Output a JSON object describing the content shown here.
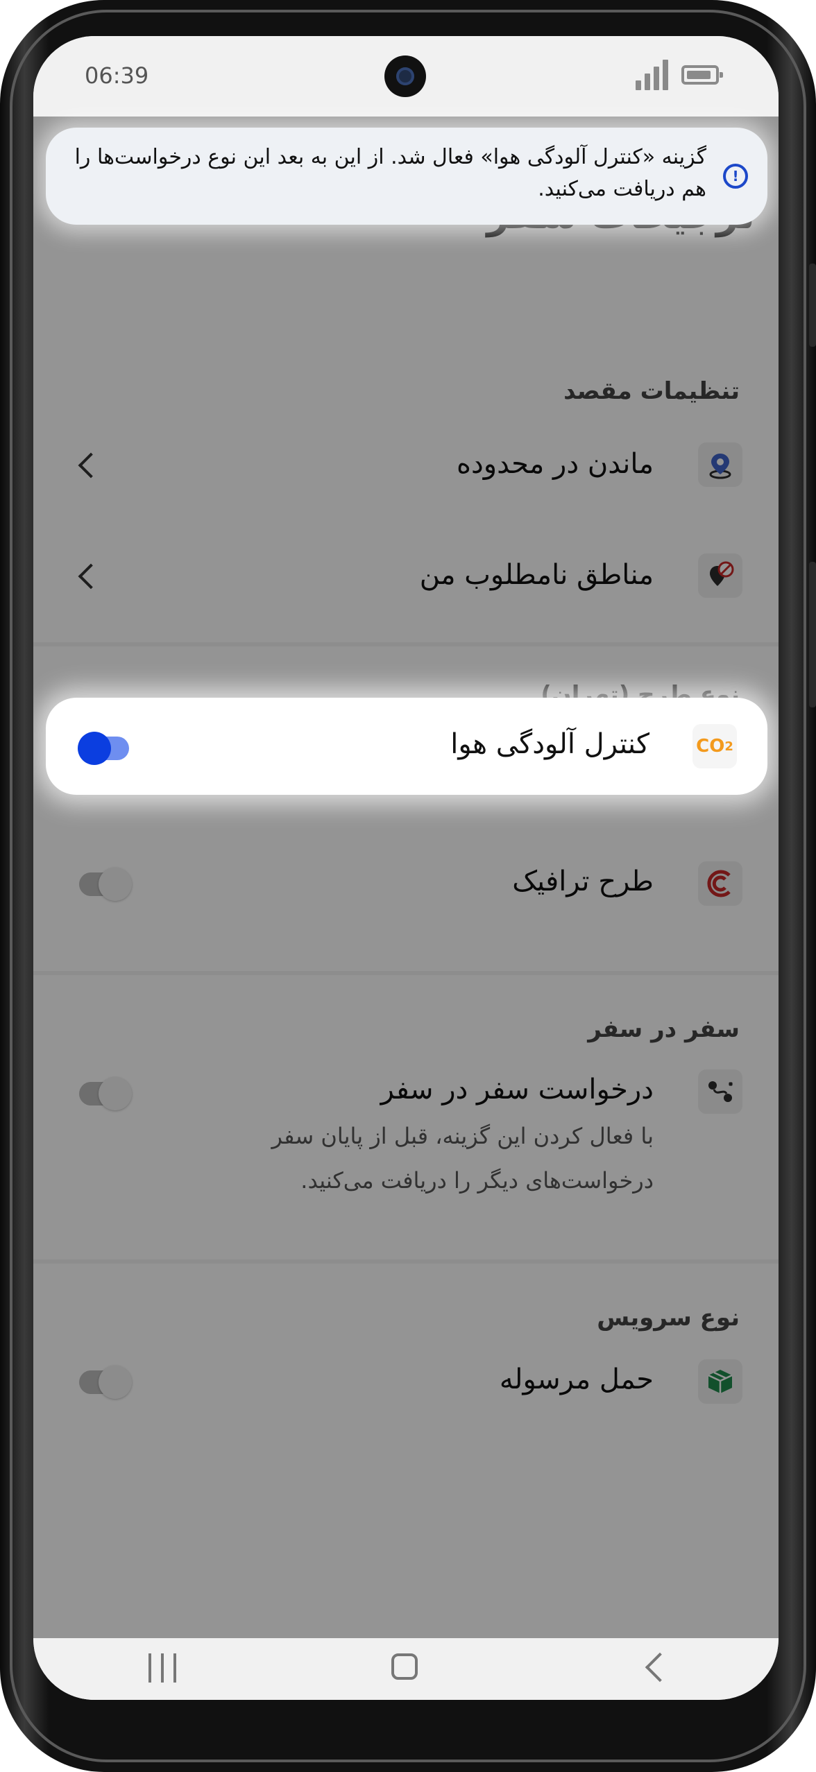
{
  "status_bar": {
    "time": "06:39"
  },
  "banner": {
    "icon": "info-icon",
    "text": "گزینه «کنترل آلودگی هوا» فعال شد. از این به بعد این نوع درخواست‌ها را هم دریافت می‌کنید."
  },
  "page": {
    "title": "ترجیحات سفر"
  },
  "sections": {
    "destination": {
      "title": "تنظیمات مقصد",
      "items": [
        {
          "label": "ماندن در محدوده",
          "icon": "location-pin-icon"
        },
        {
          "label": "مناطق نامطلوب من",
          "icon": "blocked-location-icon"
        }
      ]
    },
    "plan_type": {
      "title": "نوع طرح (تهران)",
      "items": [
        {
          "label": "کنترل آلودگی هوا",
          "icon": "co2-icon",
          "icon_text": "CO",
          "icon_sub": "2",
          "enabled": true
        },
        {
          "label": "طرح ترافیک",
          "icon": "traffic-plan-icon",
          "enabled": false
        }
      ]
    },
    "trip_in_trip": {
      "title": "سفر در سفر",
      "items": [
        {
          "label": "درخواست سفر در سفر",
          "description": "با فعال کردن این گزینه، قبل از پایان سفر درخواست‌های دیگر را دریافت می‌کنید.",
          "icon": "route-icon",
          "enabled": false
        }
      ]
    },
    "service_type": {
      "title": "نوع سرویس",
      "items": [
        {
          "label": "حمل مرسوله",
          "icon": "parcel-icon",
          "enabled": false
        }
      ]
    }
  },
  "colors": {
    "accent_blue": "#0b3ee0",
    "co2_orange": "#f39a1d",
    "traffic_red": "#c62828",
    "parcel_green": "#1f8a4c",
    "pin_blue": "#3f63c9"
  },
  "nav_bar": {
    "items": [
      "recent-apps-icon",
      "home-icon",
      "back-icon"
    ]
  }
}
